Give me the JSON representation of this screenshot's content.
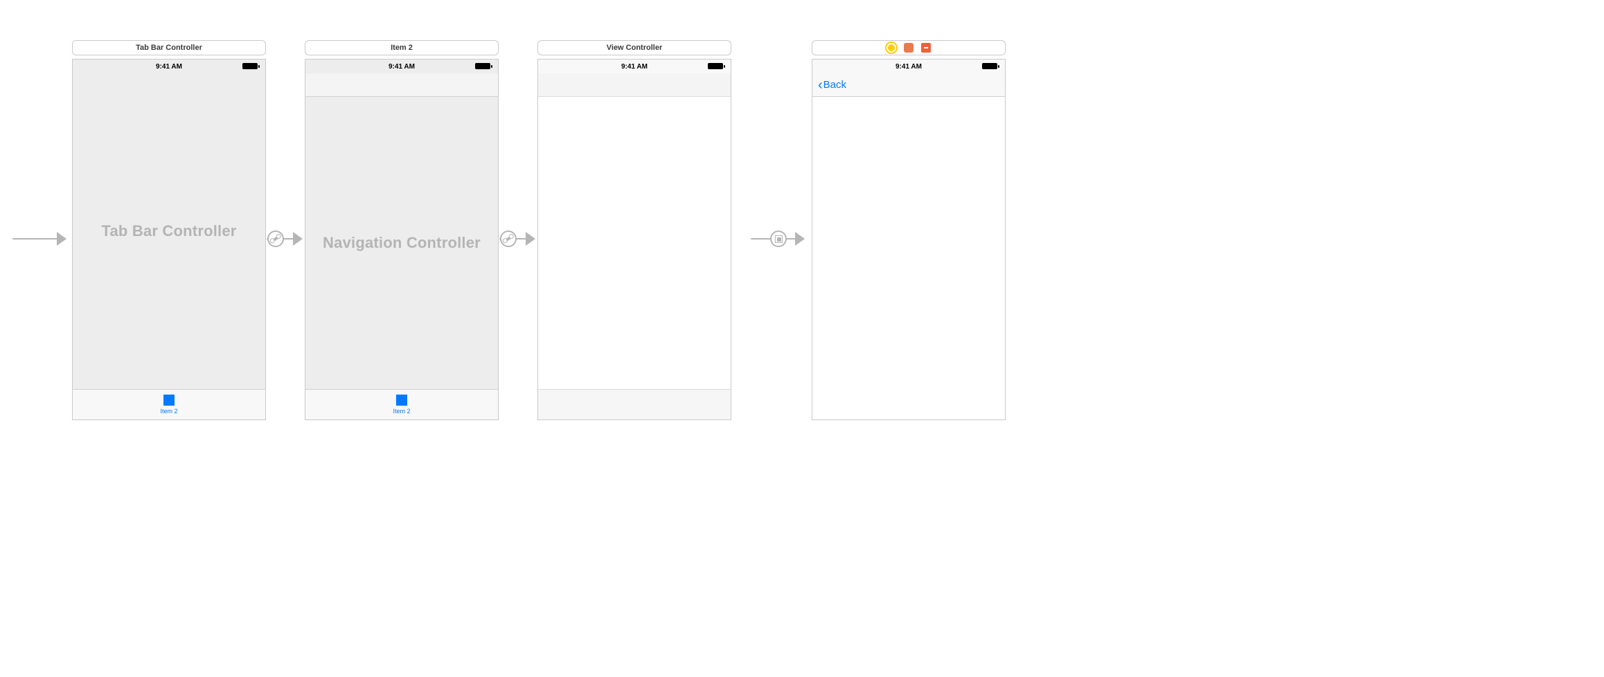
{
  "status_bar_time": "9:41 AM",
  "scenes": {
    "tab_bar_controller": {
      "title": "Tab Bar Controller",
      "placeholder_label": "Tab Bar Controller",
      "tab_item_label": "Item 2"
    },
    "navigation_controller": {
      "title": "Item 2",
      "placeholder_label": "Navigation Controller",
      "tab_item_label": "Item 2"
    },
    "view_controller": {
      "title": "View Controller"
    },
    "detail_view_controller": {
      "back_label": "Back"
    }
  },
  "segues": {
    "initial": {
      "type": "initial"
    },
    "tab_to_nav": {
      "type": "relationship"
    },
    "nav_to_view": {
      "type": "relationship"
    },
    "view_to_detail": {
      "type": "show"
    }
  }
}
